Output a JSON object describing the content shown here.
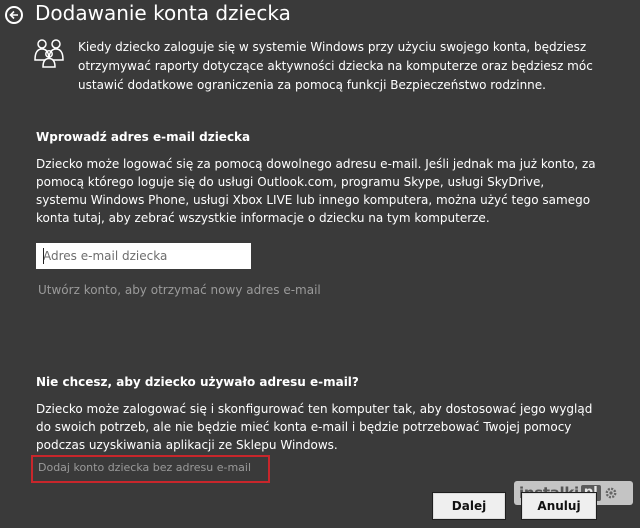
{
  "header": {
    "title": "Dodawanie konta dziecka"
  },
  "intro": {
    "icon": "family-icon",
    "text": "Kiedy dziecko zaloguje się w systemie Windows przy użyciu swojego konta, będziesz otrzymywać raporty dotyczące aktywności dziecka na komputerze oraz będziesz móc ustawić dodatkowe ograniczenia za pomocą funkcji Bezpieczeństwo rodzinne."
  },
  "email_section": {
    "heading": "Wprowadź adres e-mail dziecka",
    "text": "Dziecko może logować się za pomocą dowolnego adresu e-mail. Jeśli jednak ma już konto, za pomocą którego loguje się do usługi Outlook.com, programu Skype, usługi SkyDrive, systemu Windows Phone, usługi Xbox LIVE lub innego komputera, można użyć tego samego konta tutaj, aby zebrać wszystkie informacje o dziecku na tym komputerze.",
    "input_placeholder": "Adres e-mail dziecka",
    "input_value": "",
    "create_link": "Utwórz konto, aby otrzymać nowy adres e-mail"
  },
  "no_email_section": {
    "heading": "Nie chcesz, aby dziecko używało adresu e-mail?",
    "text": "Dziecko może zalogować się i skonfigurować ten komputer tak, aby dostosować jego wygląd do swoich potrzeb, ale nie będzie mieć konta e-mail i będzie potrzebować Twojej pomocy podczas uzyskiwania aplikacji ze Sklepu Windows.",
    "link": "Dodaj konto dziecka bez adresu e-mail"
  },
  "buttons": {
    "next": "Dalej",
    "cancel": "Anuluj"
  },
  "watermark": {
    "text": "instalki",
    "suffix": "pl"
  },
  "colors": {
    "background": "#3a3a3a",
    "link": "#9a9a9a",
    "highlight": "#c8262b"
  }
}
